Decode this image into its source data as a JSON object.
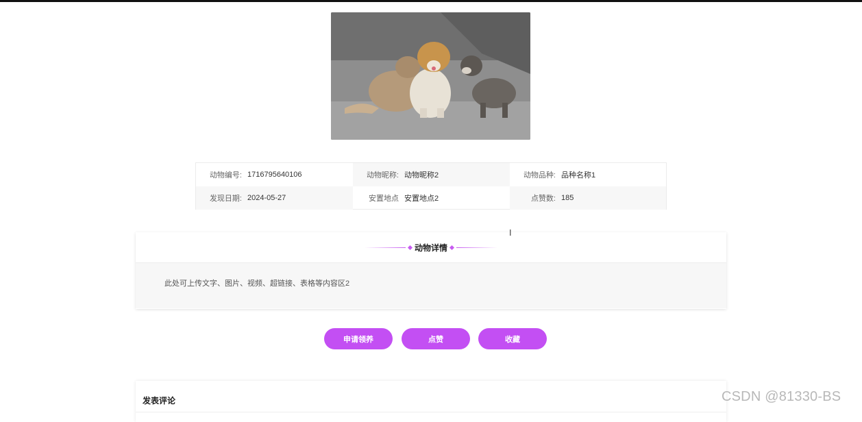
{
  "info": {
    "number_label": "动物编号:",
    "number_value": "1716795640106",
    "nickname_label": "动物昵称:",
    "nickname_value": "动物昵称2",
    "breed_label": "动物品种:",
    "breed_value": "品种名称1",
    "found_label": "发现日期:",
    "found_value": "2024-05-27",
    "place_label": "安置地点",
    "place_value": "安置地点2",
    "likes_label": "点赞数:",
    "likes_value": "185"
  },
  "detail": {
    "title": "动物详情",
    "content": "此处可上传文字、图片、视频、超链接、表格等内容区2"
  },
  "buttons": {
    "adopt": "申请领养",
    "like": "点赞",
    "favorite": "收藏"
  },
  "comment": {
    "title": "发表评论"
  },
  "watermark": "CSDN @81330-BS",
  "colors": {
    "accent": "#c34ff3"
  }
}
